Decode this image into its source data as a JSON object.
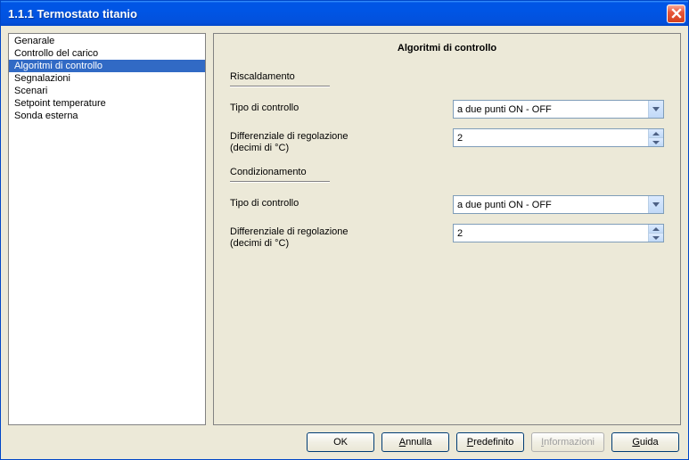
{
  "window": {
    "title": "1.1.1 Termostato titanio"
  },
  "sidebar": {
    "items": [
      {
        "label": "Genarale",
        "selected": false
      },
      {
        "label": "Controllo del carico",
        "selected": false
      },
      {
        "label": "Algoritmi di controllo",
        "selected": true
      },
      {
        "label": "Segnalazioni",
        "selected": false
      },
      {
        "label": "Scenari",
        "selected": false
      },
      {
        "label": "Setpoint temperature",
        "selected": false
      },
      {
        "label": "Sonda esterna",
        "selected": false
      }
    ]
  },
  "content": {
    "title": "Algoritmi di controllo",
    "sections": {
      "heating": {
        "label": "Riscaldamento",
        "rows": {
          "type": {
            "label": "Tipo di controllo",
            "value": "a due punti ON - OFF"
          },
          "diff": {
            "label": "Differenziale di regolazione\n(decimi di °C)",
            "value": "2"
          }
        }
      },
      "cooling": {
        "label": "Condizionamento",
        "rows": {
          "type": {
            "label": "Tipo di controllo",
            "value": "a due punti ON - OFF"
          },
          "diff": {
            "label": "Differenziale di regolazione\n(decimi di °C)",
            "value": "2"
          }
        }
      }
    }
  },
  "buttons": {
    "ok": "OK",
    "cancel_pre": "",
    "cancel_ul": "A",
    "cancel_post": "nnulla",
    "default_pre": "",
    "default_ul": "P",
    "default_post": "redefinito",
    "info_pre": "",
    "info_ul": "I",
    "info_post": "nformazioni",
    "help_pre": "",
    "help_ul": "G",
    "help_post": "uida"
  }
}
